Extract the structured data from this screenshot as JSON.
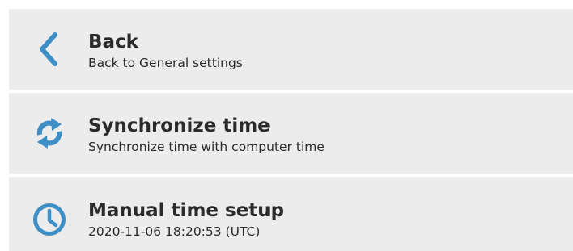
{
  "colors": {
    "accent": "#3d8fc6",
    "item_background": "#ececec",
    "text": "#2b2b2b"
  },
  "items": [
    {
      "icon": "chevron-left-icon",
      "title": "Back",
      "subtitle": "Back to General settings"
    },
    {
      "icon": "sync-icon",
      "title": "Synchronize time",
      "subtitle": "Synchronize time with computer time"
    },
    {
      "icon": "clock-icon",
      "title": "Manual time setup",
      "subtitle": "2020-11-06 18:20:53 (UTC)"
    }
  ]
}
